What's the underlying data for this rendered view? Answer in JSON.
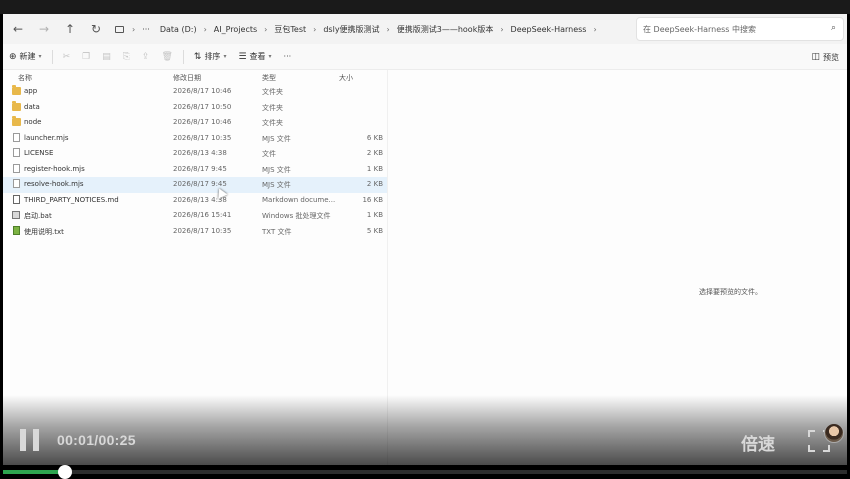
{
  "explorer": {
    "address": {
      "breadcrumb": [
        "Data (D:)",
        "AI_Projects",
        "豆包Test",
        "dsly便携版测试",
        "便携版测试3——hook版本",
        "DeepSeek-Harness"
      ],
      "more": "···",
      "search_placeholder": "在 DeepSeek-Harness 中搜索"
    },
    "toolbar": {
      "new_label": "新建",
      "sort_label": "排序",
      "view_label": "查看",
      "more_label": "···",
      "preview_label": "预览"
    },
    "columns": {
      "name": "名称",
      "modified": "修改日期",
      "type": "类型",
      "size": "大小"
    },
    "files": [
      {
        "name": "app",
        "modified": "2026/8/17 10:46",
        "type": "文件夹",
        "size": "",
        "icon": "folder-icon"
      },
      {
        "name": "data",
        "modified": "2026/8/17 10:50",
        "type": "文件夹",
        "size": "",
        "icon": "folder-icon"
      },
      {
        "name": "node",
        "modified": "2026/8/17 10:46",
        "type": "文件夹",
        "size": "",
        "icon": "folder-icon"
      },
      {
        "name": "launcher.mjs",
        "modified": "2026/8/17 10:35",
        "type": "MJS 文件",
        "size": "6 KB",
        "icon": "file-icon"
      },
      {
        "name": "LICENSE",
        "modified": "2026/8/13 4:38",
        "type": "文件",
        "size": "2 KB",
        "icon": "file-icon"
      },
      {
        "name": "register-hook.mjs",
        "modified": "2026/8/17 9:45",
        "type": "MJS 文件",
        "size": "1 KB",
        "icon": "file-icon"
      },
      {
        "name": "resolve-hook.mjs",
        "modified": "2026/8/17 9:45",
        "type": "MJS 文件",
        "size": "2 KB",
        "icon": "file-icon",
        "selected": true
      },
      {
        "name": "THIRD_PARTY_NOTICES.md",
        "modified": "2026/8/13 4:38",
        "type": "Markdown docume...",
        "size": "16 KB",
        "icon": "markdown-file-icon"
      },
      {
        "name": "启动.bat",
        "modified": "2026/8/16 15:41",
        "type": "Windows 批处理文件",
        "size": "1 KB",
        "icon": "batch-file-icon"
      },
      {
        "name": "使用说明.txt",
        "modified": "2026/8/17 10:35",
        "type": "TXT 文件",
        "size": "5 KB",
        "icon": "text-file-icon"
      }
    ],
    "preview_message": "选择要预览的文件。"
  },
  "player": {
    "time": "00:01/00:25",
    "speed_label": "倍速",
    "progress": 0.073,
    "accent": "#2ea44f"
  }
}
